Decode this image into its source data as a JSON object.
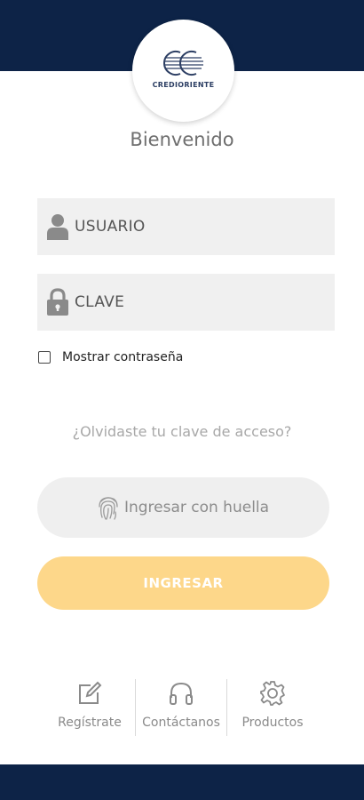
{
  "brand": {
    "logo_text": "CREDIORIENTE",
    "primary_color": "#0d2347",
    "accent_color": "#fdd78a"
  },
  "welcome": "Bienvenido",
  "fields": {
    "user": {
      "placeholder": "USUARIO",
      "icon": "user-icon"
    },
    "password": {
      "placeholder": "CLAVE",
      "icon": "lock-icon"
    }
  },
  "show_password": {
    "label": "Mostrar contraseña",
    "checked": false
  },
  "forgot_link": "¿Olvidaste tu clave de acceso?",
  "fingerprint_button": {
    "label": "Ingresar con huella",
    "icon": "fingerprint-icon"
  },
  "login_button": {
    "label": "INGRESAR"
  },
  "footer": {
    "items": [
      {
        "label": "Regístrate",
        "icon": "edit-icon"
      },
      {
        "label": "Contáctanos",
        "icon": "headphones-icon"
      },
      {
        "label": "Productos",
        "icon": "gear-icon"
      }
    ]
  }
}
